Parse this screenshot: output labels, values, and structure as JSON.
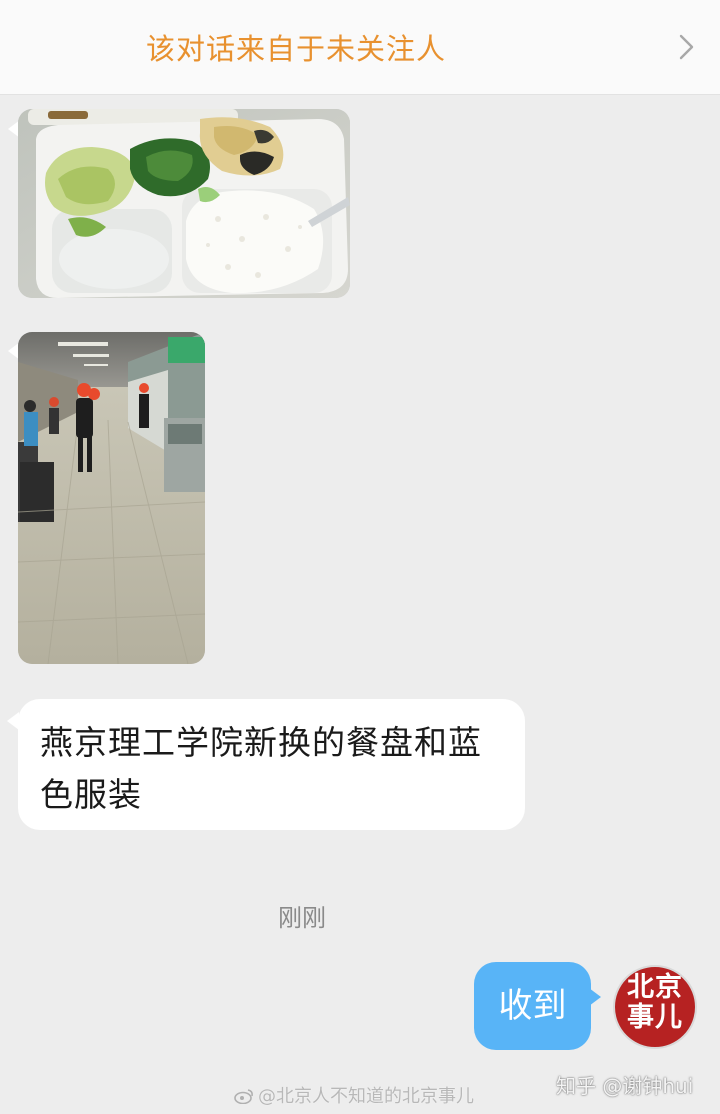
{
  "header": {
    "notice": "该对话来自于未关注人",
    "chevron_icon": "chevron-right-icon"
  },
  "messages": [
    {
      "direction": "received",
      "kind": "image",
      "subject": "meal-tray-photo"
    },
    {
      "direction": "received",
      "kind": "image",
      "subject": "canteen-hall-photo"
    },
    {
      "direction": "received",
      "kind": "text",
      "text_line1": "燕京理工学院新换的餐盘和蓝",
      "text_line2": "色服装"
    }
  ],
  "timestamp": "刚刚",
  "reply": {
    "text": "收到",
    "avatar_line1": "北京",
    "avatar_line2": "事儿",
    "avatar_color": "#b62222"
  },
  "watermarks": {
    "weibo": "@北京人不知道的北京事儿",
    "zhihu": "知乎 @谢钟hui"
  },
  "colors": {
    "notice": "#e8912f",
    "sent_bubble": "#58b4f7",
    "background": "#ededed"
  }
}
